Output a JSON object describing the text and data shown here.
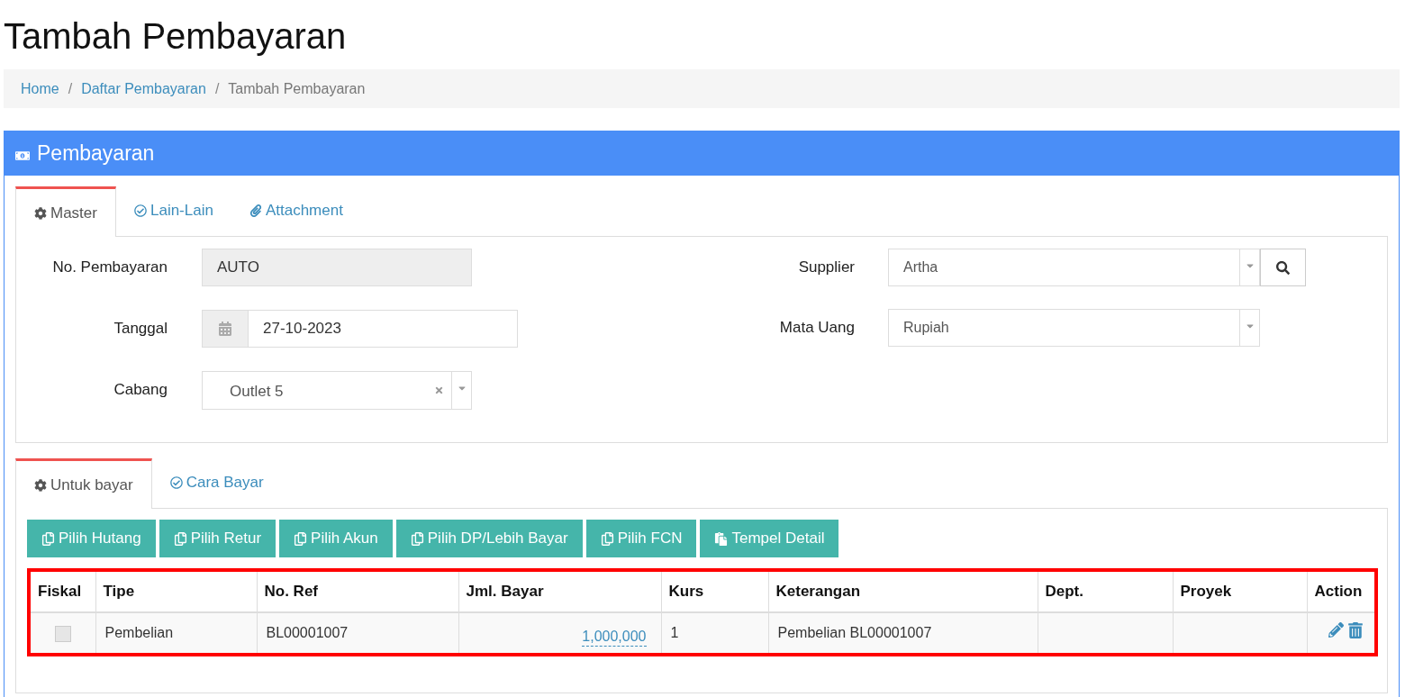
{
  "page_title": "Tambah Pembayaran",
  "breadcrumb": [
    {
      "label": "Home",
      "selected": false
    },
    {
      "separator": "/",
      "label": "Daftar Pembayaran",
      "selected": false
    },
    {
      "separator": "/",
      "label": "Tambah Pembayaran",
      "selected": true
    }
  ],
  "panel": {
    "title": "Pembayaran"
  },
  "master_tabs": [
    {
      "label": "Master",
      "selected": true
    },
    {
      "label": "Lain-Lain",
      "selected": false
    },
    {
      "label": "Attachment",
      "selected": false
    }
  ],
  "left_fields": [
    {
      "label": "No. Pembayaran",
      "kind": "readonly",
      "value": "AUTO"
    },
    {
      "label": "Tanggal",
      "kind": "date",
      "value": "27-10-2023"
    },
    {
      "label": "Cabang",
      "kind": "clearable",
      "value": "Outlet 5"
    }
  ],
  "right_fields": [
    {
      "label": "Supplier",
      "kind": "search",
      "value": "Artha"
    },
    {
      "label": "Mata Uang",
      "kind": "select",
      "value": "Rupiah"
    }
  ],
  "detail_tabs": [
    {
      "label": "Untuk bayar",
      "selected": true
    },
    {
      "label": "Cara Bayar",
      "selected": false
    }
  ],
  "buttons": [
    {
      "label": "Pilih Hutang",
      "kind": "copy"
    },
    {
      "label": "Pilih Retur",
      "kind": "copy"
    },
    {
      "label": "Pilih Akun",
      "kind": "copy"
    },
    {
      "label": "Pilih DP/Lebih Bayar",
      "kind": "copy"
    },
    {
      "label": "Pilih FCN",
      "kind": "copy"
    },
    {
      "label": "Tempel Detail",
      "kind": "paste"
    }
  ],
  "table": {
    "highlighted": true,
    "columns": [
      "Fiskal",
      "Tipe",
      "No. Ref",
      "Jml. Bayar",
      "Kurs",
      "Keterangan",
      "Dept.",
      "Proyek",
      "Action"
    ],
    "rows": [
      {
        "fiskal_checked": false,
        "tipe": "Pembelian",
        "no_ref": "BL00001007",
        "jml_bayar": "1,000,000",
        "kurs": "1",
        "keterangan": "Pembelian BL00001007"
      }
    ]
  }
}
